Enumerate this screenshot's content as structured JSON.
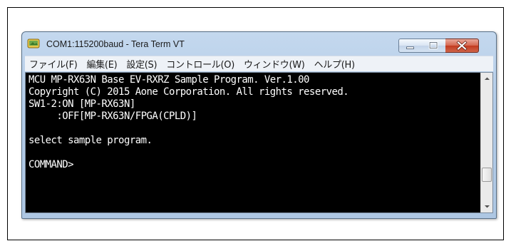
{
  "window": {
    "title": "COM1:115200baud - Tera Term VT",
    "icon": "tera-term-icon",
    "accent_color": "#b3cce8"
  },
  "menu": {
    "items": [
      {
        "label": "ファイル(F)"
      },
      {
        "label": "編集(E)"
      },
      {
        "label": "設定(S)"
      },
      {
        "label": "コントロール(O)"
      },
      {
        "label": "ウィンドウ(W)"
      },
      {
        "label": "ヘルプ(H)"
      }
    ]
  },
  "terminal": {
    "background": "#000000",
    "foreground": "#ffffff",
    "lines": [
      "MCU MP-RX63N Base EV-RXRZ Sample Program. Ver.1.00",
      "Copyright (C) 2015 Aone Corporation. All rights reserved.",
      "SW1-2:ON [MP-RX63N]",
      "     :OFF[MP-RX63N/FPGA(CPLD)]",
      "",
      "select sample program.",
      "",
      "COMMAND>"
    ]
  }
}
